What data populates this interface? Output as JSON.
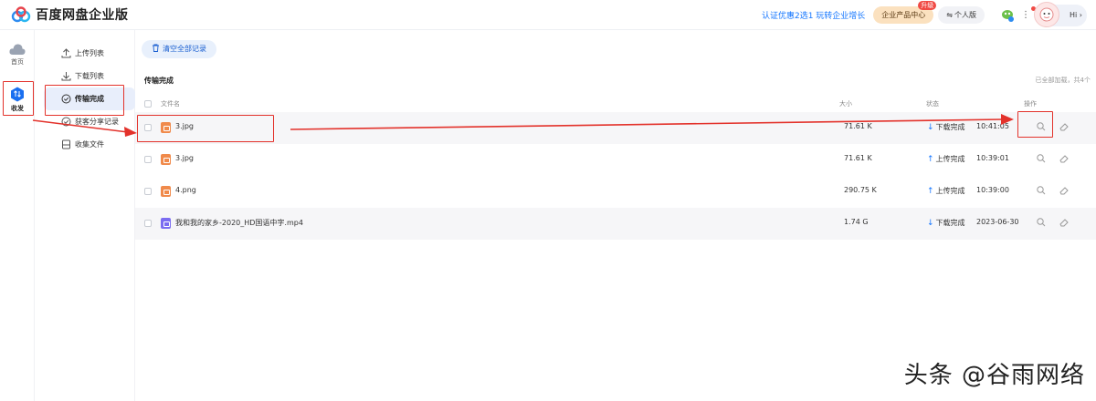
{
  "app": {
    "title": "百度网盘企业版"
  },
  "topbar": {
    "promo_link": "认证优惠2选1 玩转企业增长",
    "enterprise_button": "企业产品中心",
    "enterprise_badge": "升级",
    "personal_button": "个人版",
    "avatar_text": "Hi"
  },
  "rail": {
    "items": [
      {
        "label": "首页",
        "icon": "cloud-icon"
      },
      {
        "label": "收发",
        "icon": "transfer-icon"
      }
    ]
  },
  "subnav": {
    "items": [
      {
        "label": "上传列表",
        "icon": "upload-icon"
      },
      {
        "label": "下载列表",
        "icon": "download-icon"
      },
      {
        "label": "传输完成",
        "icon": "check-circle-icon"
      },
      {
        "label": "获客分享记录",
        "icon": "share-record-icon"
      },
      {
        "label": "收集文件",
        "icon": "collect-icon"
      }
    ]
  },
  "main": {
    "clear_all_label": "清空全部记录",
    "section_title": "传输完成",
    "loaded_note": "已全部加载，共4个",
    "columns": {
      "name": "文件名",
      "size": "大小",
      "status": "状态",
      "actions": "操作"
    },
    "rows": [
      {
        "name": "3.jpg",
        "type": "img",
        "size": "71.61 K",
        "status": "下载完成",
        "direction": "down",
        "time": "10:41:05"
      },
      {
        "name": "3.jpg",
        "type": "img",
        "size": "71.61 K",
        "status": "上传完成",
        "direction": "up",
        "time": "10:39:01"
      },
      {
        "name": "4.png",
        "type": "img",
        "size": "290.75 K",
        "status": "上传完成",
        "direction": "up",
        "time": "10:39:00"
      },
      {
        "name": "我和我的家乡-2020_HD国语中字.mp4",
        "type": "vid",
        "size": "1.74 G",
        "status": "下载完成",
        "direction": "down",
        "time": "2023-06-30"
      }
    ]
  },
  "watermark": "头条 @谷雨网络",
  "colors": {
    "accent": "#1677ff",
    "annotation": "#e3322b",
    "enterprise_bg": "#fbe1bf"
  }
}
